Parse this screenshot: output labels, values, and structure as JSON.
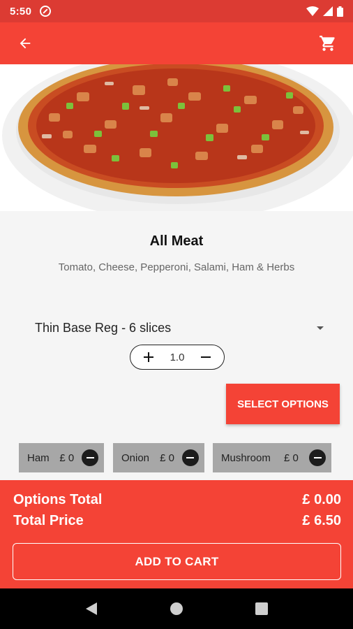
{
  "status_bar": {
    "time": "5:50"
  },
  "app_bar": {
    "back_icon": "arrow-left-icon",
    "cart_icon": "cart-icon"
  },
  "product": {
    "name": "All Meat",
    "description": "Tomato, Cheese, Pepperoni, Salami, Ham & Herbs"
  },
  "size": {
    "selected": "Thin Base Reg - 6 slices"
  },
  "quantity": {
    "value": "1.0"
  },
  "select_options_label": "SELECT OPTIONS",
  "options": [
    {
      "name": "Ham",
      "price": "£ 0"
    },
    {
      "name": "Onion",
      "price": "£ 0"
    },
    {
      "name": "Mushroom",
      "price": "£ 0"
    }
  ],
  "footer": {
    "options_total_label": "Options Total",
    "options_total_value": "£ 0.00",
    "total_price_label": "Total Price",
    "total_price_value": "£ 6.50",
    "add_to_cart_label": "ADD TO CART"
  },
  "colors": {
    "accent": "#f44336",
    "status": "#dc3b33",
    "chip": "#a7a7a7"
  }
}
